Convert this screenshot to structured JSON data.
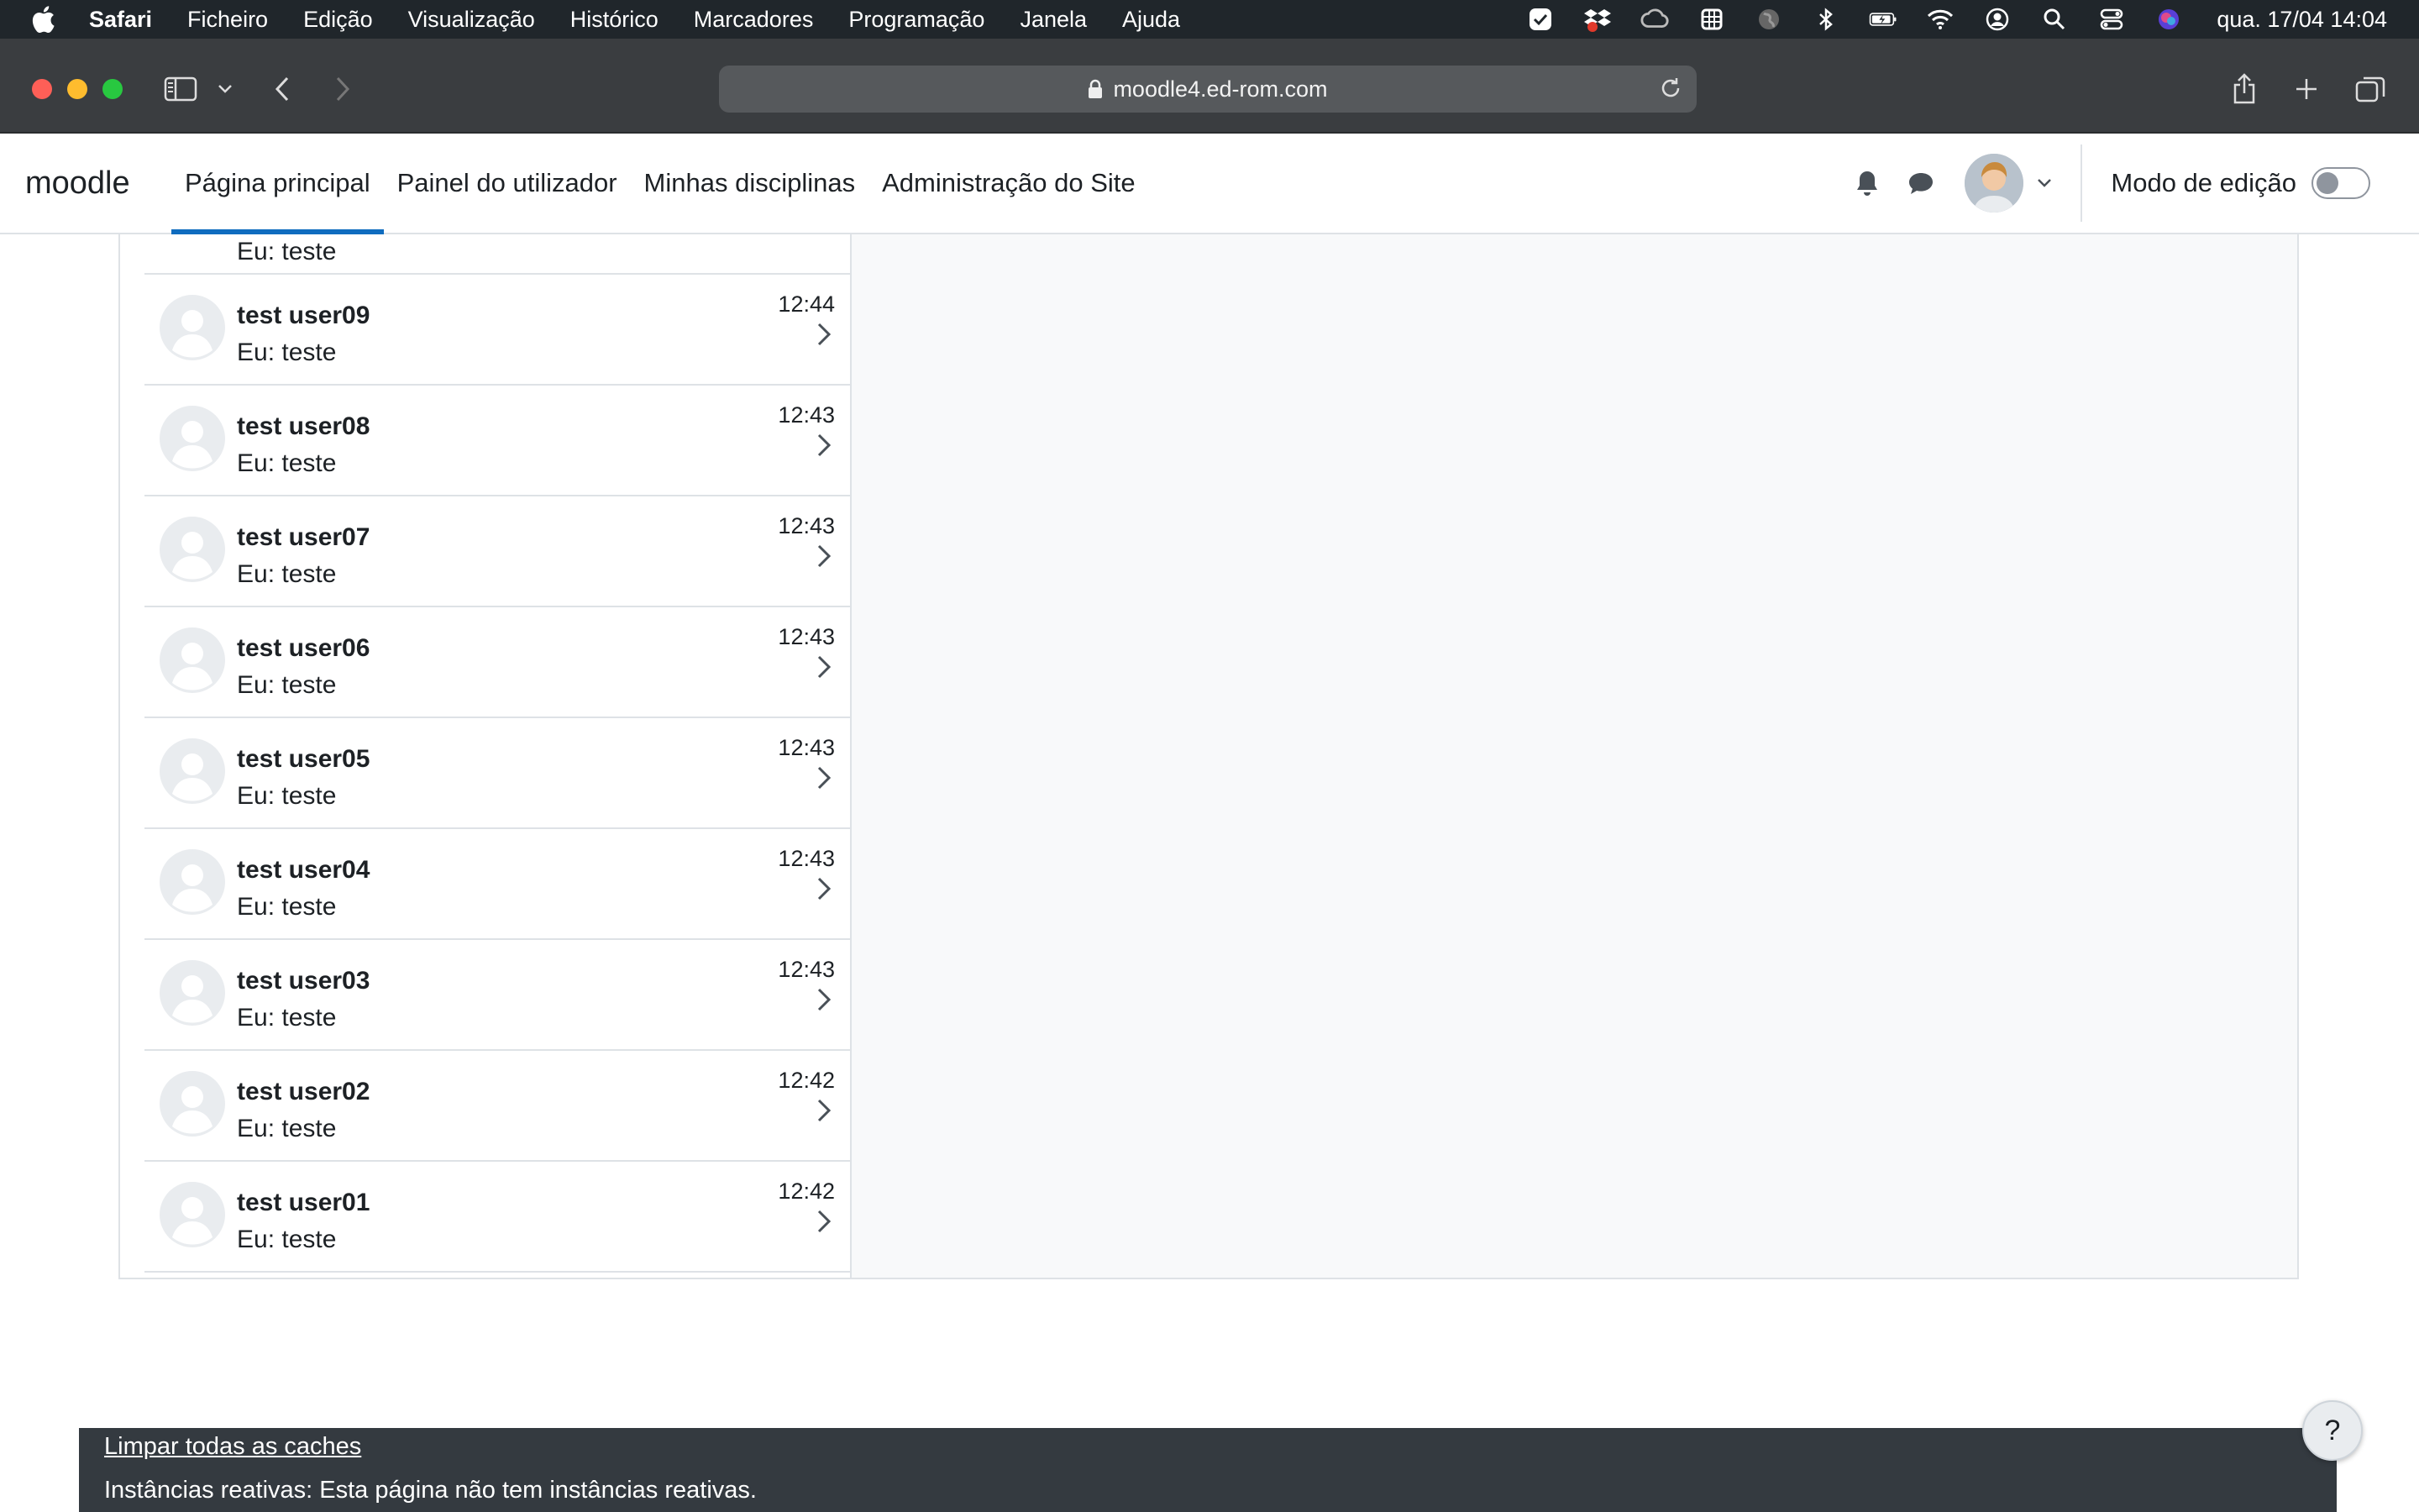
{
  "menubar": {
    "app": "Safari",
    "items": [
      "Ficheiro",
      "Edição",
      "Visualização",
      "Histórico",
      "Marcadores",
      "Programação",
      "Janela",
      "Ajuda"
    ],
    "clock": "qua. 17/04  14:04"
  },
  "browser": {
    "url": "moodle4.ed-rom.com"
  },
  "navbar": {
    "brand": "moodle",
    "links": [
      "Página principal",
      "Painel do utilizador",
      "Minhas disciplinas",
      "Administração do Site"
    ],
    "edit_mode_label": "Modo de edição"
  },
  "conversations": {
    "partial": {
      "message": "Eu: teste"
    },
    "items": [
      {
        "name": "test user09",
        "message": "Eu: teste",
        "time": "12:44"
      },
      {
        "name": "test user08",
        "message": "Eu: teste",
        "time": "12:43"
      },
      {
        "name": "test user07",
        "message": "Eu: teste",
        "time": "12:43"
      },
      {
        "name": "test user06",
        "message": "Eu: teste",
        "time": "12:43"
      },
      {
        "name": "test user05",
        "message": "Eu: teste",
        "time": "12:43"
      },
      {
        "name": "test user04",
        "message": "Eu: teste",
        "time": "12:43"
      },
      {
        "name": "test user03",
        "message": "Eu: teste",
        "time": "12:43"
      },
      {
        "name": "test user02",
        "message": "Eu: teste",
        "time": "12:42"
      },
      {
        "name": "test user01",
        "message": "Eu: teste",
        "time": "12:42"
      }
    ]
  },
  "footer": {
    "purge_caches": "Limpar todas as caches",
    "reactive_instances": "Instâncias reativas: Esta página não tem instâncias reativas.",
    "help": "?"
  },
  "colors": {
    "accent": "#0f6cbf",
    "footer_bg": "#343a40"
  }
}
